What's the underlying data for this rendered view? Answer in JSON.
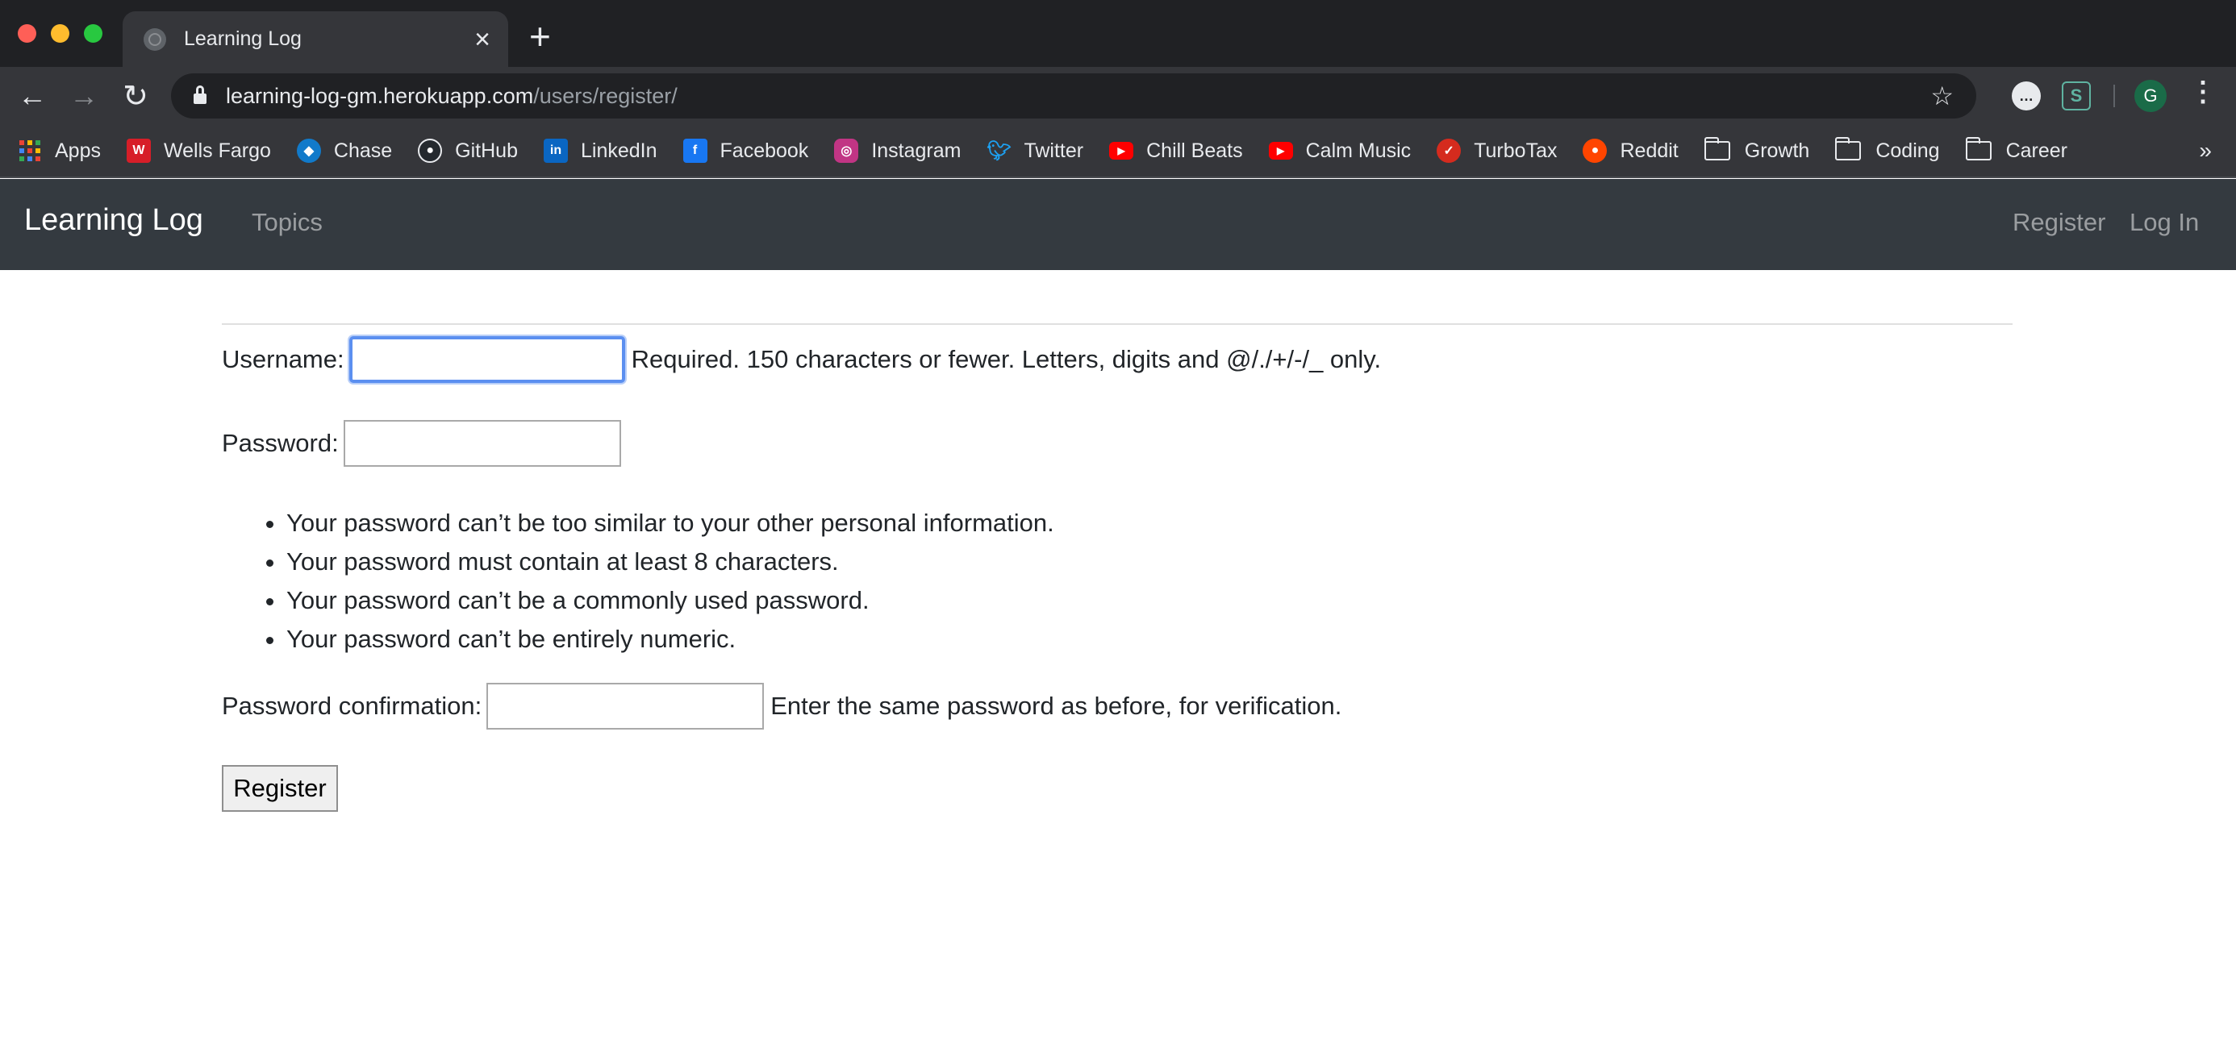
{
  "browser": {
    "tab_title": "Learning Log",
    "url_host": "learning-log-gm.herokuapp.com",
    "url_path": "/users/register/",
    "avatar_initial": "G",
    "bookmarks": [
      {
        "label": "Apps",
        "icon": "apps-grid-icon"
      },
      {
        "label": "Wells Fargo",
        "icon": "wells-fargo-icon",
        "color": "#d71e28"
      },
      {
        "label": "Chase",
        "icon": "chase-icon",
        "color": "#117aca"
      },
      {
        "label": "GitHub",
        "icon": "github-icon",
        "color": "#24292e"
      },
      {
        "label": "LinkedIn",
        "icon": "linkedin-icon",
        "color": "#0a66c2"
      },
      {
        "label": "Facebook",
        "icon": "facebook-icon",
        "color": "#1877f2"
      },
      {
        "label": "Instagram",
        "icon": "instagram-icon",
        "color": "#c13584"
      },
      {
        "label": "Twitter",
        "icon": "twitter-icon",
        "color": "#1da1f2"
      },
      {
        "label": "Chill Beats",
        "icon": "youtube-icon",
        "color": "#ff0000"
      },
      {
        "label": "Calm Music",
        "icon": "youtube-icon",
        "color": "#ff0000"
      },
      {
        "label": "TurboTax",
        "icon": "turbotax-icon",
        "color": "#d52b1e"
      },
      {
        "label": "Reddit",
        "icon": "reddit-icon",
        "color": "#ff4500"
      },
      {
        "label": "Growth",
        "icon": "folder-icon"
      },
      {
        "label": "Coding",
        "icon": "folder-icon"
      },
      {
        "label": "Career",
        "icon": "folder-icon"
      }
    ],
    "more_label": "»"
  },
  "navbar": {
    "brand": "Learning Log",
    "topics": "Topics",
    "register": "Register",
    "login": "Log In",
    "bg_color": "#343a40"
  },
  "form": {
    "username_label": "Username:",
    "username_value": "",
    "username_help": "Required. 150 characters or fewer. Letters, digits and @/./+/-/_ only.",
    "password_label": "Password:",
    "password_value": "",
    "password_help": [
      "Your password can’t be too similar to your other personal information.",
      "Your password must contain at least 8 characters.",
      "Your password can’t be a commonly used password.",
      "Your password can’t be entirely numeric."
    ],
    "confirm_label": "Password confirmation:",
    "confirm_value": "",
    "confirm_help": "Enter the same password as before, for verification.",
    "submit_label": "Register"
  }
}
